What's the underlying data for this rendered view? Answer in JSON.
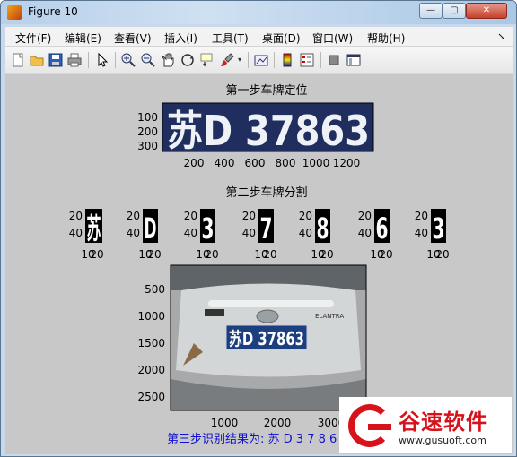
{
  "window": {
    "title": "Figure 10",
    "minimize": "—",
    "maximize": "▢",
    "close": "✕"
  },
  "menu": [
    "文件(F)",
    "编辑(E)",
    "查看(V)",
    "插入(I)",
    "工具(T)",
    "桌面(D)",
    "窗口(W)",
    "帮助(H)"
  ],
  "menu_overflow": "↘",
  "toolbar_icons": [
    "new-figure-icon",
    "open-file-icon",
    "save-icon",
    "print-icon",
    "pointer-icon",
    "zoom-in-icon",
    "zoom-out-icon",
    "pan-hand-icon",
    "rotate-3d-icon",
    "data-cursor-icon",
    "brush-icon",
    "brush-dropdown-icon",
    "link-plot-icon",
    "colorbar-icon",
    "legend-icon",
    "hide-plot-tools-icon",
    "show-plot-tools-icon"
  ],
  "plot1": {
    "title": "第一步车牌定位",
    "plate_text": "苏D 37863",
    "yticks": [
      "100",
      "200",
      "300"
    ],
    "xticks": [
      "200",
      "400",
      "600",
      "800",
      "1000",
      "1200"
    ]
  },
  "plot2": {
    "title": "第二步车牌分割",
    "chars": [
      "苏",
      "D",
      "3",
      "7",
      "8",
      "6",
      "3"
    ],
    "yticks": [
      "20",
      "40"
    ],
    "xticks": [
      "10",
      "20"
    ]
  },
  "plot3": {
    "yticks": [
      "500",
      "1000",
      "1500",
      "2000",
      "2500"
    ],
    "xticks": [
      "1000",
      "2000",
      "3000"
    ],
    "plate_text": "苏D 37863",
    "car_badge": "ELANTRA"
  },
  "result": "第三步识别结果为: 苏 D 3 7 8 6",
  "watermark": {
    "brand": "谷速软件",
    "url": "www.gusuoft.com"
  }
}
